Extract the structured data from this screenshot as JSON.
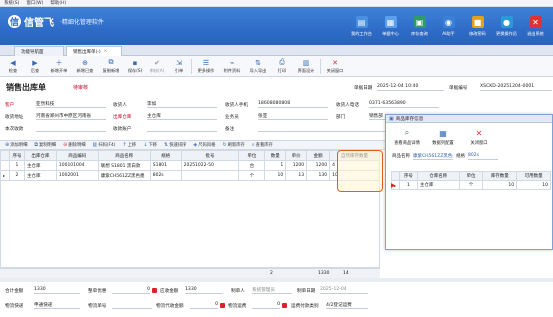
{
  "menu": [
    "系统(S)",
    "窗口(W)",
    "帮助(H)"
  ],
  "brand": {
    "logo_char": "信",
    "name": "信管飞",
    "slogan": "·精细化管理软件"
  },
  "topbar": [
    {
      "label": "我的工作台",
      "icon": "monitor-icon",
      "color": "#4a8fe0",
      "glyph": "▤"
    },
    {
      "label": "单据中心",
      "icon": "document-icon",
      "color": "#3a7fd8",
      "glyph": "▦"
    },
    {
      "label": "库存查询",
      "icon": "inventory-icon",
      "color": "#2f9b6a",
      "glyph": "▣"
    },
    {
      "label": "AI助手",
      "icon": "ai-icon",
      "color": "#3a7fd8",
      "glyph": "◉"
    },
    {
      "label": "修改密码",
      "icon": "lock-icon",
      "color": "#e0a21a",
      "glyph": "🔒"
    },
    {
      "label": "更换操作员",
      "icon": "user-switch-icon",
      "color": "#2a9ad6",
      "glyph": "👤"
    },
    {
      "label": "退出系统",
      "icon": "exit-icon",
      "color": "#d33",
      "glyph": "✕"
    }
  ],
  "tabs": [
    {
      "label": "功能导航面"
    },
    {
      "label": "销售出库单(-)",
      "close": "×"
    }
  ],
  "toolbar": [
    {
      "label": "检查",
      "glyph": "◀"
    },
    {
      "label": "后查",
      "glyph": "▶"
    },
    {
      "label": "新增开单",
      "glyph": "＋"
    },
    {
      "label": "新增已查",
      "glyph": "⊕"
    },
    {
      "label": "复制新增",
      "glyph": "⧉"
    },
    {
      "label": "保存(S)",
      "glyph": "💾"
    },
    {
      "label": "审核(A)",
      "glyph": "✔"
    },
    {
      "label": "引单",
      "glyph": "⇲"
    },
    {
      "label": "更多操作",
      "glyph": "☰"
    },
    {
      "label": "附件资料",
      "glyph": "📎"
    },
    {
      "label": "导入导出",
      "glyph": "⇅"
    },
    {
      "label": "打印",
      "glyph": "⎙"
    },
    {
      "label": "界面设计",
      "glyph": "▥"
    },
    {
      "label": "关闭窗口",
      "glyph": "✕"
    }
  ],
  "doc": {
    "title": "销售出库单",
    "status": "待审核",
    "date_label": "单据日期",
    "date_value": "2025-12-04 10:40",
    "no_label": "单据编号",
    "no_value": "XSCKD-20251204-0001"
  },
  "header_fields": [
    {
      "label": "客户",
      "value": "亚然科技",
      "label_class": "link"
    },
    {
      "label": "收货人",
      "value": "李如"
    },
    {
      "label": "收货人手机",
      "value": "18608080808"
    },
    {
      "label": "收货人电话",
      "value": "0371-63563890"
    },
    {
      "label": "收货地址",
      "value": "河南省郑州市中原区河南省"
    },
    {
      "label": "出库仓库",
      "value": "主仓库",
      "label_class": "link"
    },
    {
      "label": "业务员",
      "value": "张亚"
    },
    {
      "label": "部门",
      "value": "销售部"
    },
    {
      "label": "本次收款",
      "value": ""
    },
    {
      "label": "收款账户",
      "value": ""
    },
    {
      "label": "备注",
      "value": ""
    }
  ],
  "grid_toolbar": [
    "添加明细",
    "复制明细",
    "删除明细",
    "扫码(F4)",
    "上移",
    "下移",
    "快速排序",
    "尺码风格",
    "刷新库存",
    "查看库存"
  ],
  "grid": {
    "headers": [
      "序号",
      "出库仓库",
      "商品编码",
      "商品名称",
      "规格",
      "批号",
      "单位",
      "数量",
      "单价",
      "金额",
      "自然库存数量"
    ],
    "rows": [
      [
        "1",
        "主仓库",
        "100101004",
        "联想 S1801 黑白款",
        "S1801",
        "20251022-50",
        "台",
        "1",
        "1200",
        "1200",
        "4"
      ],
      [
        "2",
        "主仓库",
        "1002001",
        "康紫CH561ZZ黑色墨",
        "802s",
        "",
        "个",
        "10",
        "13",
        "130",
        "10"
      ]
    ],
    "totals": {
      "qty": "2",
      "amount": "1330",
      "stock": "14"
    }
  },
  "footer": {
    "total_label": "合计金额",
    "total_value": "1330",
    "discount_label": "整单优惠",
    "discount_value": "0",
    "due_label": "应收金额",
    "due_value": "1330",
    "maker_label": "制单人",
    "maker_value": "系统管理员",
    "make_date_label": "制单日期",
    "make_date_value": "2025-12-04",
    "ship_co_label": "物流快递",
    "ship_co_value": "申通快递",
    "ship_no_label": "物流单号",
    "ship_no_value": "",
    "ship_fee_label": "物流代收金额",
    "ship_fee_value": "0",
    "freight_label": "物流运费",
    "freight_value": "0",
    "freight_mode_label": "运费付款类别",
    "freight_mode_value": "4/2登记运费"
  },
  "popup": {
    "title": "商品库存信息",
    "buttons": [
      {
        "label": "查看商品详情",
        "glyph": "🔍"
      },
      {
        "label": "数据列配置",
        "glyph": "▦"
      },
      {
        "label": "关闭窗口",
        "glyph": "✕"
      }
    ],
    "info_label": "商品名称",
    "info_value": "康紫CH561ZZ黑色墨盒",
    "spec_label": "规格",
    "spec_value": "802s",
    "headers": [
      "序号",
      "仓库名称",
      "单位",
      "库存数量",
      "可用数量"
    ],
    "rows": [
      [
        "1",
        "主仓库",
        "个",
        "10",
        "10"
      ]
    ]
  }
}
